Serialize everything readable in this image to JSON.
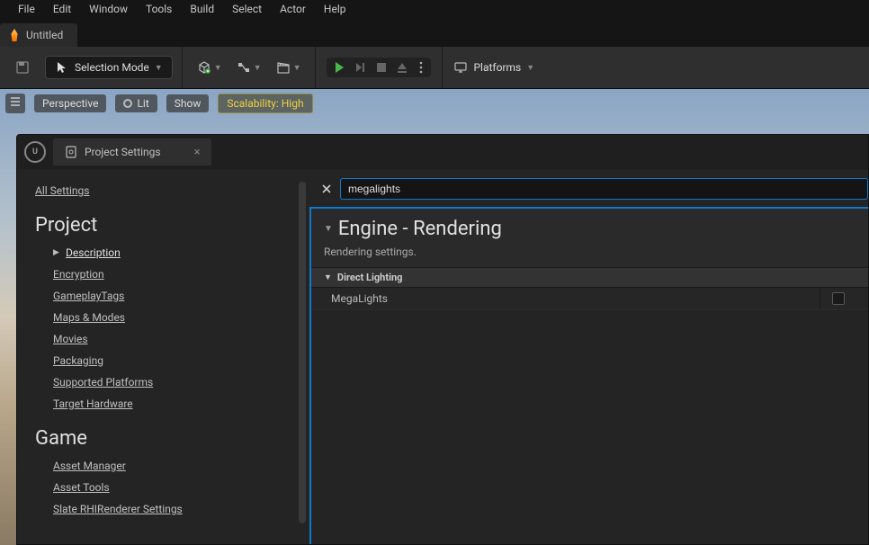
{
  "menu": {
    "items": [
      "File",
      "Edit",
      "Window",
      "Tools",
      "Build",
      "Select",
      "Actor",
      "Help"
    ]
  },
  "mainTab": {
    "label": "Untitled"
  },
  "toolbar": {
    "modeLabel": "Selection Mode",
    "platformsLabel": "Platforms"
  },
  "viewportBar": {
    "perspective": "Perspective",
    "lit": "Lit",
    "show": "Show",
    "scalability": "Scalability: High"
  },
  "settingsWindow": {
    "tabTitle": "Project Settings",
    "allSettings": "All Settings",
    "groups": {
      "project": {
        "header": "Project",
        "items": [
          "Description",
          "Encryption",
          "GameplayTags",
          "Maps & Modes",
          "Movies",
          "Packaging",
          "Supported Platforms",
          "Target Hardware"
        ]
      },
      "game": {
        "header": "Game",
        "items": [
          "Asset Manager",
          "Asset Tools",
          "Slate RHIRenderer Settings"
        ]
      }
    },
    "search": {
      "value": "megalights"
    },
    "detail": {
      "title": "Engine - Rendering",
      "subtitle": "Rendering settings.",
      "category": "Direct Lighting",
      "property": "MegaLights"
    }
  }
}
